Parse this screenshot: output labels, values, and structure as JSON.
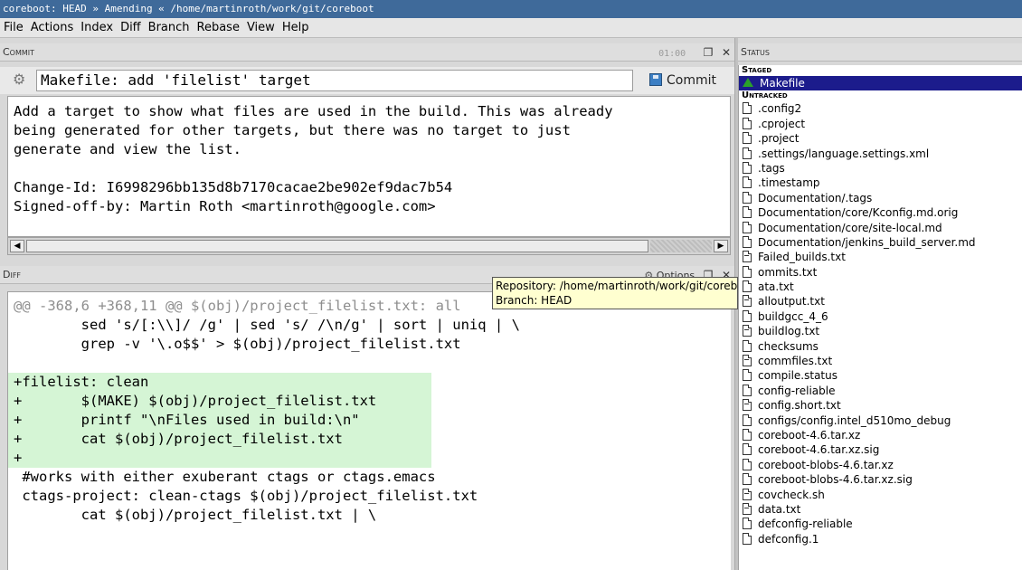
{
  "window": {
    "title": "coreboot: HEAD » Amending « /home/martinroth/work/git/coreboot"
  },
  "menu": [
    "File",
    "Actions",
    "Index",
    "Diff",
    "Branch",
    "Rebase",
    "View",
    "Help"
  ],
  "commit": {
    "header": "Commit",
    "time": "01:00",
    "summary": "Makefile: add 'filelist' target",
    "button": "Commit",
    "message": "Add a target to show what files are used in the build. This was already\nbeing generated for other targets, but there was no target to just\ngenerate and view the list.\n\nChange-Id: I6998296bb135d8b7170cacae2be902ef9dac7b54\nSigned-off-by: Martin Roth <martinroth@google.com>"
  },
  "diff": {
    "header": "Diff",
    "options": "Options",
    "lines": [
      {
        "type": "hunk",
        "text": "@@ -368,6 +368,11 @@ $(obj)/project_filelist.txt: all"
      },
      {
        "type": "ctx",
        "text": " \tsed 's/[:\\\\]/ /g' | sed 's/ /\\n/g' | sort | uniq | \\"
      },
      {
        "type": "ctx",
        "text": " \tgrep -v '\\.o$$' > $(obj)/project_filelist.txt"
      },
      {
        "type": "ctx",
        "text": " "
      },
      {
        "type": "add",
        "text": "+filelist: clean"
      },
      {
        "type": "add",
        "text": "+\t$(MAKE) $(obj)/project_filelist.txt"
      },
      {
        "type": "add",
        "text": "+\tprintf \"\\nFiles used in build:\\n\""
      },
      {
        "type": "add",
        "text": "+\tcat $(obj)/project_filelist.txt"
      },
      {
        "type": "add",
        "text": "+"
      },
      {
        "type": "ctx",
        "text": " #works with either exuberant ctags or ctags.emacs"
      },
      {
        "type": "ctx",
        "text": " ctags-project: clean-ctags $(obj)/project_filelist.txt"
      },
      {
        "type": "ctx",
        "text": " \tcat $(obj)/project_filelist.txt | \\"
      }
    ]
  },
  "tooltip": {
    "line1": "Repository: /home/martinroth/work/git/coreboot",
    "line2": "Branch: HEAD"
  },
  "status": {
    "header": "Status",
    "staged_title": "Staged",
    "staged": [
      "Makefile"
    ],
    "untracked_title": "Untracked",
    "untracked": [
      {
        "name": ".config2",
        "icon": "file-icon"
      },
      {
        "name": ".cproject",
        "icon": "file-icon"
      },
      {
        "name": ".project",
        "icon": "file-icon"
      },
      {
        "name": ".settings/language.settings.xml",
        "icon": "file-icon"
      },
      {
        "name": ".tags",
        "icon": "file-icon"
      },
      {
        "name": ".timestamp",
        "icon": "file-icon"
      },
      {
        "name": "Documentation/.tags",
        "icon": "file-icon"
      },
      {
        "name": "Documentation/core/Kconfig.md.orig",
        "icon": "file-icon"
      },
      {
        "name": "Documentation/core/site-local.md",
        "icon": "file-icon"
      },
      {
        "name": "Documentation/jenkins_build_server.md",
        "icon": "file-icon"
      },
      {
        "name": "Failed_builds.txt",
        "icon": "text-file-icon"
      },
      {
        "name": "ommits.txt",
        "icon": "file-icon"
      },
      {
        "name": "ata.txt",
        "icon": "file-icon"
      },
      {
        "name": "alloutput.txt",
        "icon": "text-file-icon"
      },
      {
        "name": "buildgcc_4_6",
        "icon": "file-icon"
      },
      {
        "name": "buildlog.txt",
        "icon": "text-file-icon"
      },
      {
        "name": "checksums",
        "icon": "file-icon"
      },
      {
        "name": "commfiles.txt",
        "icon": "text-file-icon"
      },
      {
        "name": "compile.status",
        "icon": "file-icon"
      },
      {
        "name": "config-reliable",
        "icon": "file-icon"
      },
      {
        "name": "config.short.txt",
        "icon": "text-file-icon"
      },
      {
        "name": "configs/config.intel_d510mo_debug",
        "icon": "file-icon"
      },
      {
        "name": "coreboot-4.6.tar.xz",
        "icon": "file-icon"
      },
      {
        "name": "coreboot-4.6.tar.xz.sig",
        "icon": "file-icon"
      },
      {
        "name": "coreboot-blobs-4.6.tar.xz",
        "icon": "file-icon"
      },
      {
        "name": "coreboot-blobs-4.6.tar.xz.sig",
        "icon": "file-icon"
      },
      {
        "name": "covcheck.sh",
        "icon": "text-file-icon"
      },
      {
        "name": "data.txt",
        "icon": "text-file-icon"
      },
      {
        "name": "defconfig-reliable",
        "icon": "file-icon"
      },
      {
        "name": "defconfig.1",
        "icon": "file-icon"
      }
    ]
  }
}
